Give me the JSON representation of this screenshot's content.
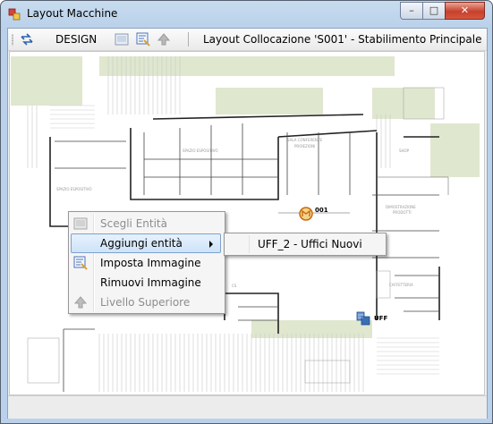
{
  "window": {
    "title": "Layout Macchine",
    "minimize_glyph": "–",
    "maximize_glyph": "□",
    "close_glyph": "✕"
  },
  "toolbar": {
    "mode_label": "DESIGN",
    "location_label": "Layout Collocazione 'S001' - Stabilimento Principale",
    "icons": [
      "swap-arrows-icon",
      "image-icon",
      "set-image-icon",
      "up-arrow-icon"
    ]
  },
  "floorplan": {
    "labels": {
      "spazio_espositivo_1": "SPAZIO ESPOSITIVO",
      "spazio_espositivo_2": "SPAZIO ESPOSITIVO",
      "sala_conferenze": "SALA CONFERENZE",
      "proiezioni": "PROIEZIONI",
      "shop": "SHOP",
      "dimostrazione": "DIMOSTRAZIONE",
      "prodotti": "PRODOTTI",
      "caffetteria": "CAFFETTERIA",
      "cs": "CS"
    },
    "markers": [
      {
        "label": "001",
        "icon": "machine-marker-icon",
        "color": "#e08a1e"
      },
      {
        "label": "UFF",
        "icon": "office-marker-icon",
        "color": "#3a6fb5"
      }
    ]
  },
  "context_menu": {
    "items": [
      {
        "label": "Scegli Entità",
        "icon": "choose-entity-icon",
        "enabled": false
      },
      {
        "label": "Aggiungi entità",
        "icon": "",
        "enabled": true,
        "highlighted": true,
        "has_submenu": true
      },
      {
        "label": "Imposta Immagine",
        "icon": "set-image-icon",
        "enabled": true
      },
      {
        "label": "Rimuovi Immagine",
        "icon": "",
        "enabled": true
      },
      {
        "label": "Livello Superiore",
        "icon": "up-arrow-icon",
        "enabled": false
      }
    ],
    "submenu": {
      "items": [
        {
          "label": "UFF_2 - Uffici Nuovi"
        }
      ]
    }
  }
}
